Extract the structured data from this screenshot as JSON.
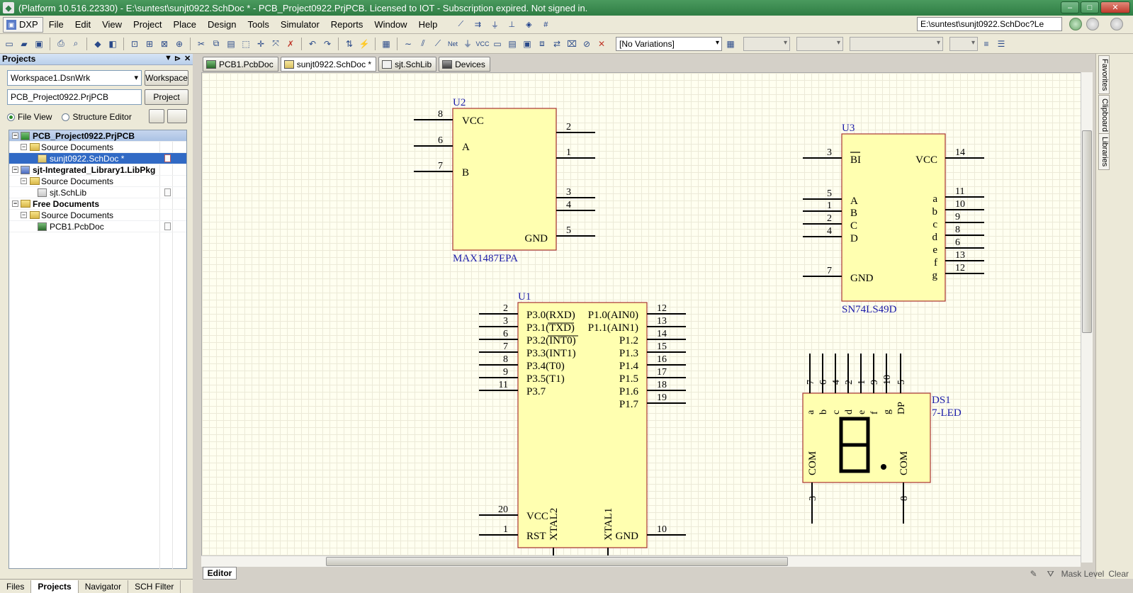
{
  "titlebar": {
    "title": "(Platform 10.516.22330) - E:\\suntest\\sunjt0922.SchDoc * - PCB_Project0922.PrjPCB. Licensed to IOT - Subscription expired. Not signed in.",
    "minimize": "–",
    "maximize": "□",
    "close": "✕"
  },
  "menubar": {
    "dxp": "DXP",
    "items": [
      "File",
      "Edit",
      "View",
      "Project",
      "Place",
      "Design",
      "Tools",
      "Simulator",
      "Reports",
      "Window",
      "Help"
    ],
    "path": "E:\\suntest\\sunjt0922.SchDoc?Le"
  },
  "toolbar": {
    "variations": "[No Variations]"
  },
  "projects_panel": {
    "title": "Projects",
    "workspace_value": "Workspace1.DsnWrk",
    "workspace_button": "Workspace",
    "project_value": "PCB_Project0922.PrjPCB",
    "project_button": "Project",
    "file_view": "File View",
    "structure_editor": "Structure Editor",
    "tree": [
      {
        "label": "PCB_Project0922.PrjPCB",
        "level": 0,
        "type": "project"
      },
      {
        "label": "Source Documents",
        "level": 1,
        "type": "folder"
      },
      {
        "label": "sunjt0922.SchDoc *",
        "level": 2,
        "type": "doc"
      },
      {
        "label": "sjt-Integrated_Library1.LibPkg",
        "level": 0,
        "type": "project"
      },
      {
        "label": "Source Documents",
        "level": 1,
        "type": "folder"
      },
      {
        "label": "sjt.SchLib",
        "level": 2,
        "type": "doc"
      },
      {
        "label": "Free Documents",
        "level": 0,
        "type": "project"
      },
      {
        "label": "Source Documents",
        "level": 1,
        "type": "folder"
      },
      {
        "label": "PCB1.PcbDoc",
        "level": 2,
        "type": "doc"
      }
    ]
  },
  "panel_tabs": [
    "Files",
    "Projects",
    "Navigator",
    "SCH Filter"
  ],
  "doc_tabs": [
    "PCB1.PcbDoc",
    "sunjt0922.SchDoc *",
    "sjt.SchLib",
    "Devices"
  ],
  "side_tabs": [
    "Favorites",
    "Clipboard",
    "Libraries"
  ],
  "editor_tab": "Editor",
  "status": {
    "mask_level": "Mask Level",
    "clear": "Clear"
  },
  "schematic": {
    "u2": {
      "designator": "U2",
      "part": "MAX1487EPA",
      "left_pins": [
        {
          "num": "8",
          "name": "VCC"
        },
        {
          "num": "6",
          "name": "A"
        },
        {
          "num": "7",
          "name": "B"
        }
      ],
      "right_pins": [
        {
          "num": "2"
        },
        {
          "num": "1"
        },
        {
          "num": "3"
        },
        {
          "num": "4"
        },
        {
          "num": "5",
          "name": "GND"
        }
      ]
    },
    "u3": {
      "designator": "U3",
      "part": "SN74LS49D",
      "left_pins": [
        {
          "num": "3",
          "name": "BI"
        },
        {
          "num": "5",
          "name": "A"
        },
        {
          "num": "1",
          "name": "B"
        },
        {
          "num": "2",
          "name": "C"
        },
        {
          "num": "4",
          "name": "D"
        },
        {
          "num": "7",
          "name": "GND"
        }
      ],
      "right_pins": [
        {
          "num": "14",
          "name": "VCC"
        },
        {
          "num": "11",
          "name": "a"
        },
        {
          "num": "10",
          "name": "b"
        },
        {
          "num": "9",
          "name": "c"
        },
        {
          "num": "8",
          "name": "d"
        },
        {
          "num": "6",
          "name": "e"
        },
        {
          "num": "13",
          "name": "f"
        },
        {
          "num": "12",
          "name": "g"
        }
      ]
    },
    "u1": {
      "designator": "U1",
      "left_pins": [
        {
          "num": "2",
          "name": "P3.0(RXD)"
        },
        {
          "num": "3",
          "name": "P3.1(TXD)"
        },
        {
          "num": "6",
          "name": "P3.2(INT0)"
        },
        {
          "num": "7",
          "name": "P3.3(INT1)"
        },
        {
          "num": "8",
          "name": "P3.4(T0)"
        },
        {
          "num": "9",
          "name": "P3.5(T1)"
        },
        {
          "num": "11",
          "name": "P3.7"
        },
        {
          "num": "20",
          "name": "VCC"
        },
        {
          "num": "1",
          "name": "RST"
        }
      ],
      "right_pins": [
        {
          "num": "12",
          "name": "P1.0(AIN0)"
        },
        {
          "num": "13",
          "name": "P1.1(AIN1)"
        },
        {
          "num": "14",
          "name": "P1.2"
        },
        {
          "num": "15",
          "name": "P1.3"
        },
        {
          "num": "16",
          "name": "P1.4"
        },
        {
          "num": "17",
          "name": "P1.5"
        },
        {
          "num": "18",
          "name": "P1.6"
        },
        {
          "num": "19",
          "name": "P1.7"
        },
        {
          "num": "10",
          "name": "GND"
        }
      ],
      "bottom_labels": [
        "XTAL2",
        "XTAL1"
      ]
    },
    "ds1": {
      "designator": "DS1",
      "part": "7-LED",
      "top_pins": [
        {
          "num": "7",
          "name": "a"
        },
        {
          "num": "6",
          "name": "b"
        },
        {
          "num": "4",
          "name": "c"
        },
        {
          "num": "2",
          "name": "d"
        },
        {
          "num": "1",
          "name": "e"
        },
        {
          "num": "9",
          "name": "f"
        },
        {
          "num": "10",
          "name": "g"
        },
        {
          "num": "5",
          "name": "DP"
        }
      ],
      "bottom_pins": [
        {
          "num": "3",
          "name": "COM"
        },
        {
          "num": "8",
          "name": "COM"
        }
      ]
    }
  }
}
